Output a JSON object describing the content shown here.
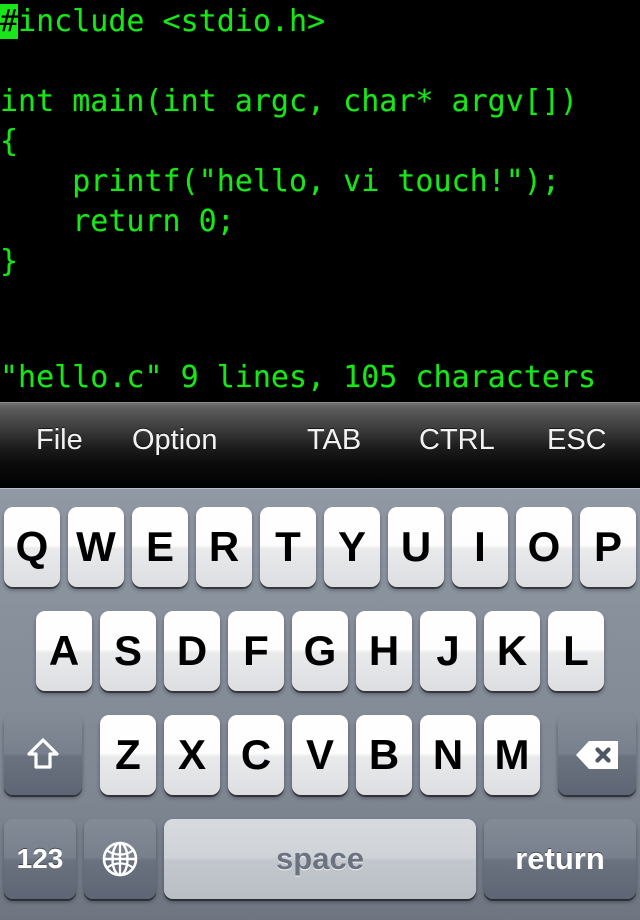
{
  "terminal": {
    "background_color": "#000000",
    "text_color": "#19e619",
    "cursor_char": "#",
    "lines": [
      "include <stdio.h>",
      "",
      "int main(int argc, char* argv[])",
      "{",
      "    printf(\"hello, vi touch!\");",
      "    return 0;",
      "}"
    ],
    "status_line": "\"hello.c\" 9 lines, 105 characters",
    "filename": "hello.c",
    "line_count": "9 lines",
    "char_count": "105 characters"
  },
  "toolbar": {
    "background_color": "#000000",
    "text_color": "#f2f2f2",
    "items": [
      {
        "label": "File",
        "name": "file"
      },
      {
        "label": "Option",
        "name": "option"
      },
      {
        "label": "TAB",
        "name": "tab"
      },
      {
        "label": "CTRL",
        "name": "ctrl"
      },
      {
        "label": "ESC",
        "name": "esc"
      }
    ]
  },
  "keyboard": {
    "background_color": "#8a929e",
    "key_face_color": "#f4f5f6",
    "key_dark_color": "#6f7783",
    "rows": [
      {
        "name": "row-qwerty",
        "keys": [
          "Q",
          "W",
          "E",
          "R",
          "T",
          "Y",
          "U",
          "I",
          "O",
          "P"
        ]
      },
      {
        "name": "row-asdf",
        "keys": [
          "A",
          "S",
          "D",
          "F",
          "G",
          "H",
          "J",
          "K",
          "L"
        ]
      },
      {
        "name": "row-zxcv",
        "keys": [
          "Z",
          "X",
          "C",
          "V",
          "B",
          "N",
          "M"
        ]
      }
    ],
    "shift_key": {
      "label": "",
      "icon": "shift-arrow-icon"
    },
    "delete_key": {
      "label": "",
      "icon": "backspace-delete-icon"
    },
    "numeric_key": {
      "label": "123"
    },
    "globe_key": {
      "label": "",
      "icon": "globe-icon"
    },
    "space_key": {
      "label": "space"
    },
    "return_key": {
      "label": "return"
    }
  }
}
